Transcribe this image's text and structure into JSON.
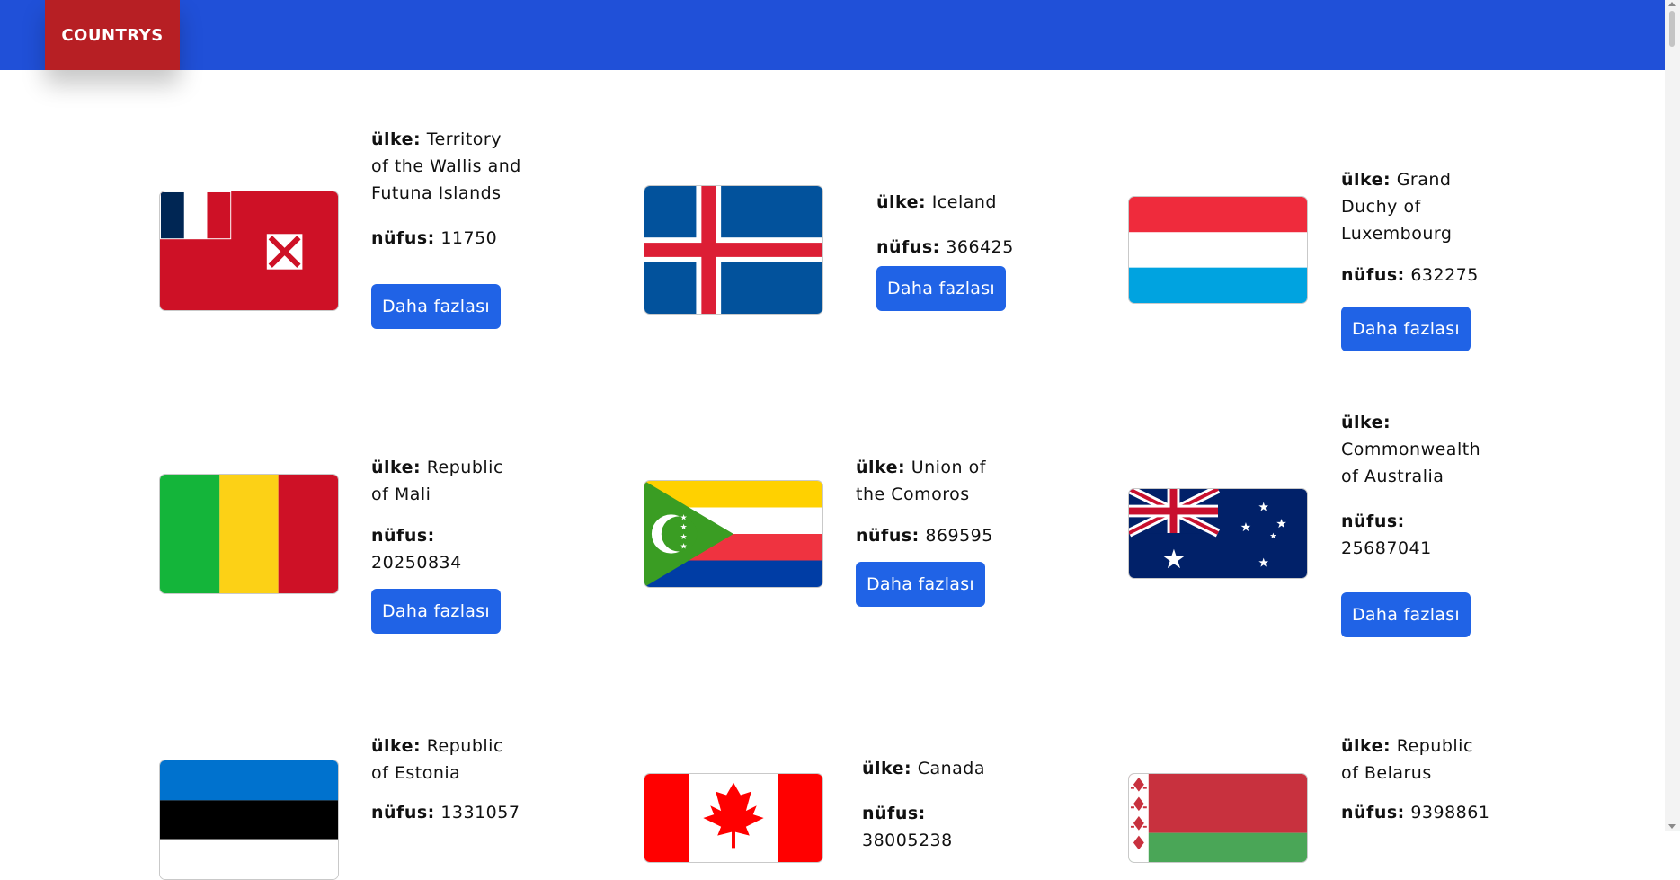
{
  "brand": "COUNTRYS",
  "labels": {
    "country": "ülke:",
    "population": "nüfus:",
    "more": "Daha fazlası"
  },
  "countries": [
    {
      "name": "Territory of the Wallis and Futuna Islands",
      "population": "11750"
    },
    {
      "name": "Iceland",
      "population": "366425"
    },
    {
      "name": "Grand Duchy of Luxembourg",
      "population": "632275"
    },
    {
      "name": "Republic of Mali",
      "population": "20250834"
    },
    {
      "name": "Union of the Comoros",
      "population": "869595"
    },
    {
      "name": "Commonwealth of Australia",
      "population": "25687041"
    },
    {
      "name": "Republic of Estonia",
      "population": "1331057"
    },
    {
      "name": "Canada",
      "population": "38005238"
    },
    {
      "name": "Republic of Belarus",
      "population": "9398861"
    }
  ],
  "colors": {
    "nav": "#2050d8",
    "brand_bg": "#b71f24",
    "button": "#2063e6"
  }
}
